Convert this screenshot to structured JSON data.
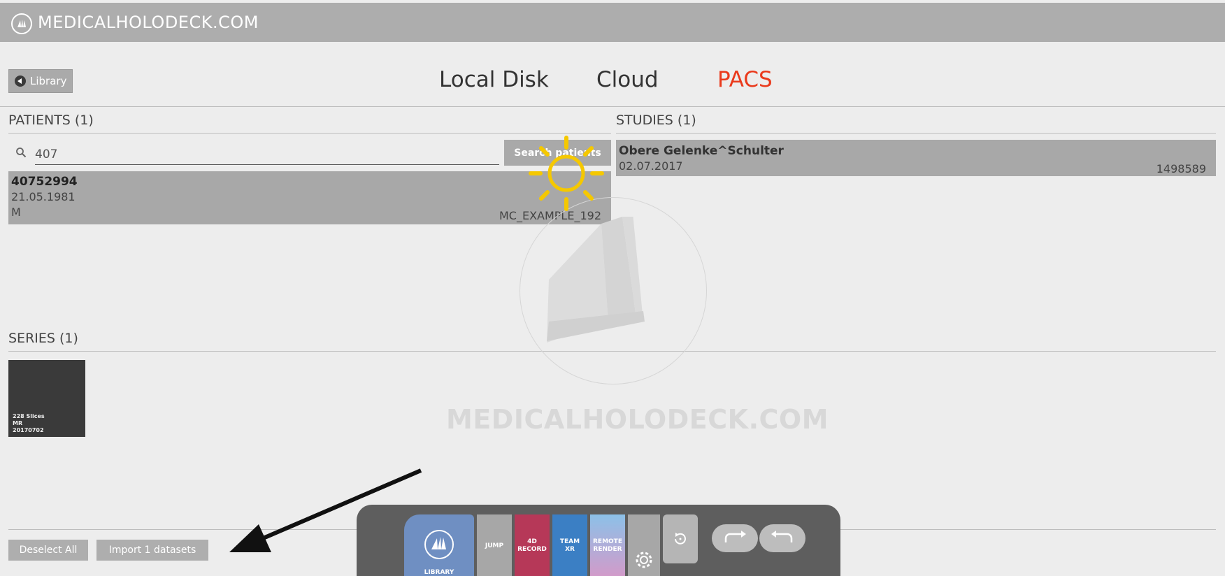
{
  "header": {
    "brand": "MEDICALHOLODECK.COM"
  },
  "library_button": {
    "label": "Library"
  },
  "tabs": [
    {
      "label": "Local Disk",
      "active": false
    },
    {
      "label": "Cloud",
      "active": false
    },
    {
      "label": "PACS",
      "active": true
    }
  ],
  "accent_color": "#ea3a1c",
  "patients": {
    "title": "PATIENTS (1)",
    "search_value": "407",
    "search_button": "Search patients",
    "rows": [
      {
        "id": "40752994",
        "dob": "21.05.1981",
        "sex": "M",
        "name": "MC_EXAMPLE_192"
      }
    ]
  },
  "studies": {
    "title": "STUDIES (1)",
    "rows": [
      {
        "name": "Obere Gelenke^Schulter",
        "date": "02.07.2017",
        "number": "1498589"
      }
    ]
  },
  "series": {
    "title": "SERIES (1)",
    "items": [
      {
        "slices": "228 Slices",
        "modality": "MR",
        "date": "20170702"
      }
    ]
  },
  "watermark": {
    "text": "MEDICALHOLODECK.COM"
  },
  "actions": {
    "deselect_all": "Deselect All",
    "import": "Import 1 datasets"
  },
  "dock": {
    "library": "LIBRARY",
    "jump": "JUMP",
    "record_line1": "4D",
    "record_line2": "RECORD",
    "team_line1": "TEAM",
    "team_line2": "XR",
    "remote_line1": "REMOTE",
    "remote_line2": "RENDER"
  }
}
